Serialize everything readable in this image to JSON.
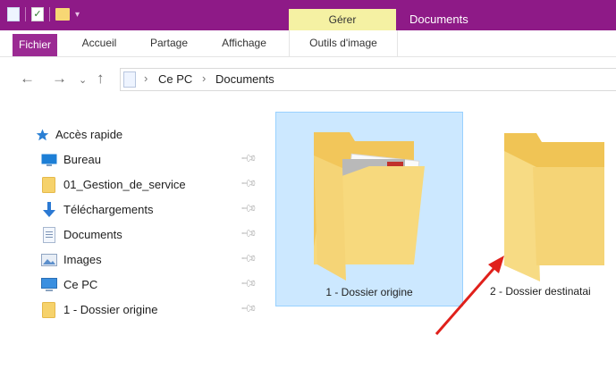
{
  "ribbon": {
    "context_tab": "Gérer",
    "window_title": "Documents",
    "tabs": [
      "Fichier",
      "Accueil",
      "Partage",
      "Affichage",
      "Outils d'image"
    ]
  },
  "address": {
    "crumbs": [
      "Ce PC",
      "Documents"
    ]
  },
  "nav": {
    "quick_access": "Accès rapide",
    "items": [
      {
        "label": "Bureau",
        "icon": "desktop-icon"
      },
      {
        "label": "01_Gestion_de_service",
        "icon": "folder-icon"
      },
      {
        "label": "Téléchargements",
        "icon": "download-icon"
      },
      {
        "label": "Documents",
        "icon": "documents-icon"
      },
      {
        "label": "Images",
        "icon": "images-icon"
      },
      {
        "label": "Ce PC",
        "icon": "computer-icon"
      },
      {
        "label": "1 - Dossier origine",
        "icon": "folder-icon"
      }
    ]
  },
  "files": [
    {
      "label": "1 - Dossier origine",
      "selected": true
    },
    {
      "label": "2 - Dossier destinatai",
      "selected": false
    }
  ],
  "colors": {
    "titlebar": "#8e1a87",
    "context_tab": "#f5f1a3",
    "selection": "#cce8ff",
    "annotation_arrow": "#e0201b"
  }
}
